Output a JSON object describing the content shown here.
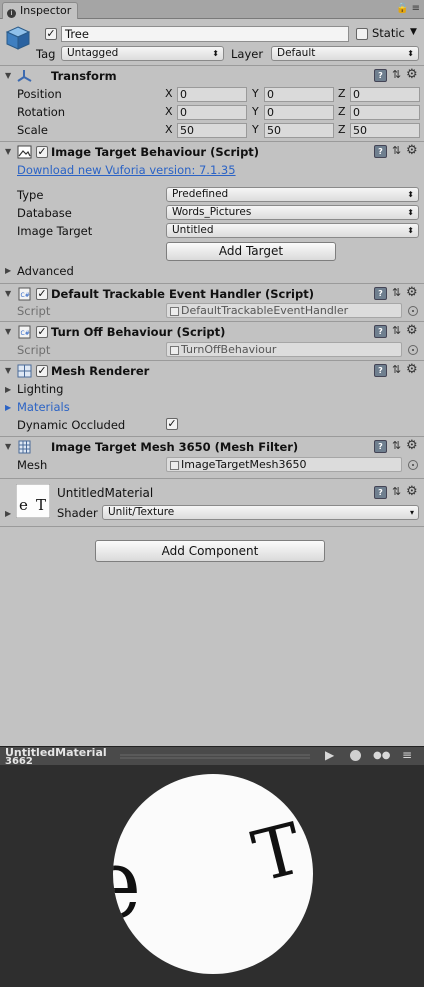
{
  "tab": {
    "label": "Inspector"
  },
  "header": {
    "name": "Tree",
    "static_label": "Static",
    "tag_label": "Tag",
    "tag_value": "Untagged",
    "layer_label": "Layer",
    "layer_value": "Default"
  },
  "transform": {
    "title": "Transform",
    "position_label": "Position",
    "rotation_label": "Rotation",
    "scale_label": "Scale",
    "axis_x": "X",
    "axis_y": "Y",
    "axis_z": "Z",
    "position": [
      "0",
      "0",
      "0"
    ],
    "rotation": [
      "0",
      "0",
      "0"
    ],
    "scale": [
      "50",
      "50",
      "50"
    ]
  },
  "image_target": {
    "title": "Image Target Behaviour (Script)",
    "download_link": "Download new Vuforia version: 7.1.35",
    "type_label": "Type",
    "type_value": "Predefined",
    "database_label": "Database",
    "database_value": "Words_Pictures",
    "image_target_label": "Image Target",
    "image_target_value": "Untitled",
    "add_target_button": "Add Target",
    "advanced_label": "Advanced"
  },
  "default_trackable": {
    "title": "Default Trackable Event Handler (Script)",
    "script_label": "Script",
    "script_value": "DefaultTrackableEventHandler"
  },
  "turn_off": {
    "title": "Turn Off Behaviour (Script)",
    "script_label": "Script",
    "script_value": "TurnOffBehaviour"
  },
  "mesh_renderer": {
    "title": "Mesh Renderer",
    "lighting_label": "Lighting",
    "materials_label": "Materials",
    "dynamic_occluded_label": "Dynamic Occluded"
  },
  "mesh_filter": {
    "title": "Image Target Mesh 3650 (Mesh Filter)",
    "mesh_label": "Mesh",
    "mesh_value": "ImageTargetMesh3650"
  },
  "material": {
    "name": "UntitledMaterial",
    "shader_label": "Shader",
    "shader_value": "Unlit/Texture"
  },
  "add_component_button": "Add Component",
  "preview": {
    "title": "UntitledMaterial",
    "subtitle": "3662"
  },
  "colors": {
    "panel": "#c2c2c2",
    "link": "#2b63c5",
    "preview_bg": "#2e2e2e"
  }
}
